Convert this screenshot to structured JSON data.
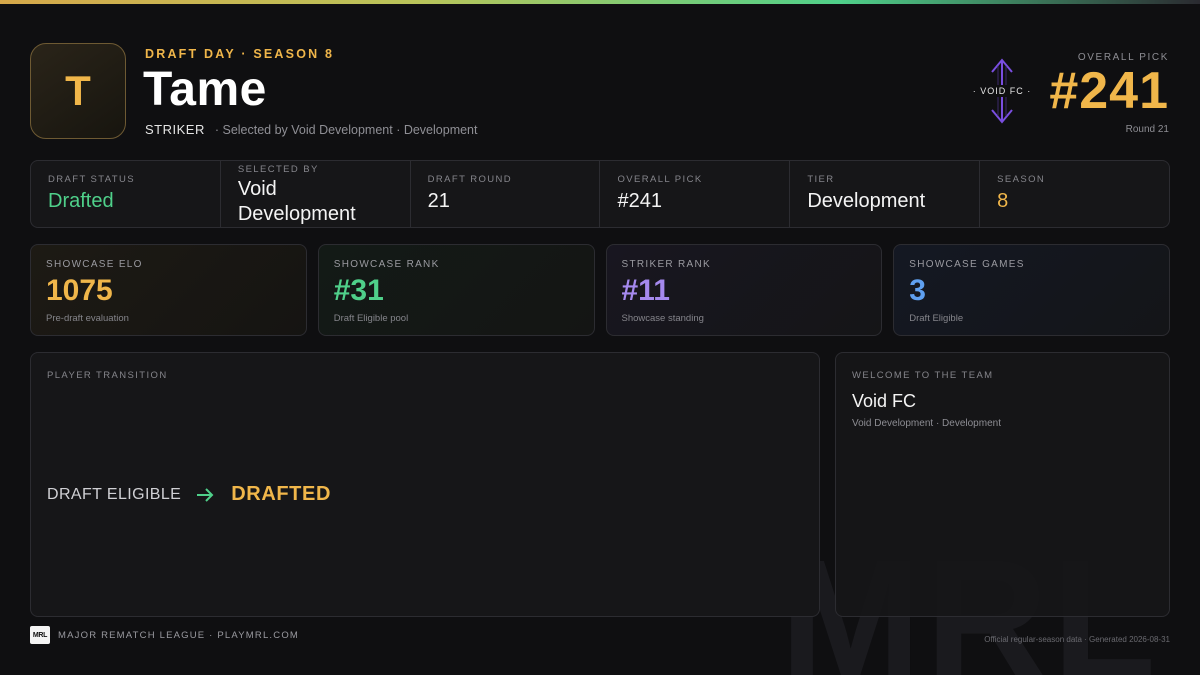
{
  "header": {
    "avatar_initial": "T",
    "eyebrow": "DRAFT DAY · SEASON 8",
    "player_name": "Tame",
    "position": "STRIKER",
    "selected_line": "· Selected by Void Development · Development",
    "crest_label": "· VOID FC ·",
    "pick_label": "OVERALL PICK",
    "pick_number": "#241",
    "pick_round": "Round 21"
  },
  "strip": [
    {
      "label": "DRAFT STATUS",
      "value": "Drafted"
    },
    {
      "label": "SELECTED BY",
      "value": "Void Development"
    },
    {
      "label": "DRAFT ROUND",
      "value": "21"
    },
    {
      "label": "OVERALL PICK",
      "value": "#241"
    },
    {
      "label": "TIER",
      "value": "Development"
    },
    {
      "label": "SEASON",
      "value": "8"
    }
  ],
  "cards": [
    {
      "label": "SHOWCASE ELO",
      "value": "1075",
      "sub": "Pre-draft evaluation"
    },
    {
      "label": "SHOWCASE RANK",
      "value": "#31",
      "sub": "Draft Eligible pool"
    },
    {
      "label": "STRIKER RANK",
      "value": "#11",
      "sub": "Showcase standing"
    },
    {
      "label": "SHOWCASE GAMES",
      "value": "3",
      "sub": "Draft Eligible"
    }
  ],
  "transition": {
    "label": "PLAYER TRANSITION",
    "from": "DRAFT ELIGIBLE",
    "to": "DRAFTED"
  },
  "welcome": {
    "label": "WELCOME TO THE TEAM",
    "team": "Void FC",
    "sub": "Void Development · Development"
  },
  "footer": {
    "logo": "MRL",
    "league": "MAJOR REMATCH LEAGUE · PLAYMRL.COM",
    "note": "Official regular-season data · Generated 2026-08-31",
    "watermark": "MRL"
  },
  "colors": {
    "accent_gold": "#f0b64a",
    "accent_green": "#4fd08a",
    "accent_purple": "#a589ee",
    "accent_blue": "#5fa0f0",
    "background": "#0f0f11"
  },
  "icons": {
    "crest": "void-fc-crest-icon",
    "arrow": "arrow-right-icon"
  }
}
